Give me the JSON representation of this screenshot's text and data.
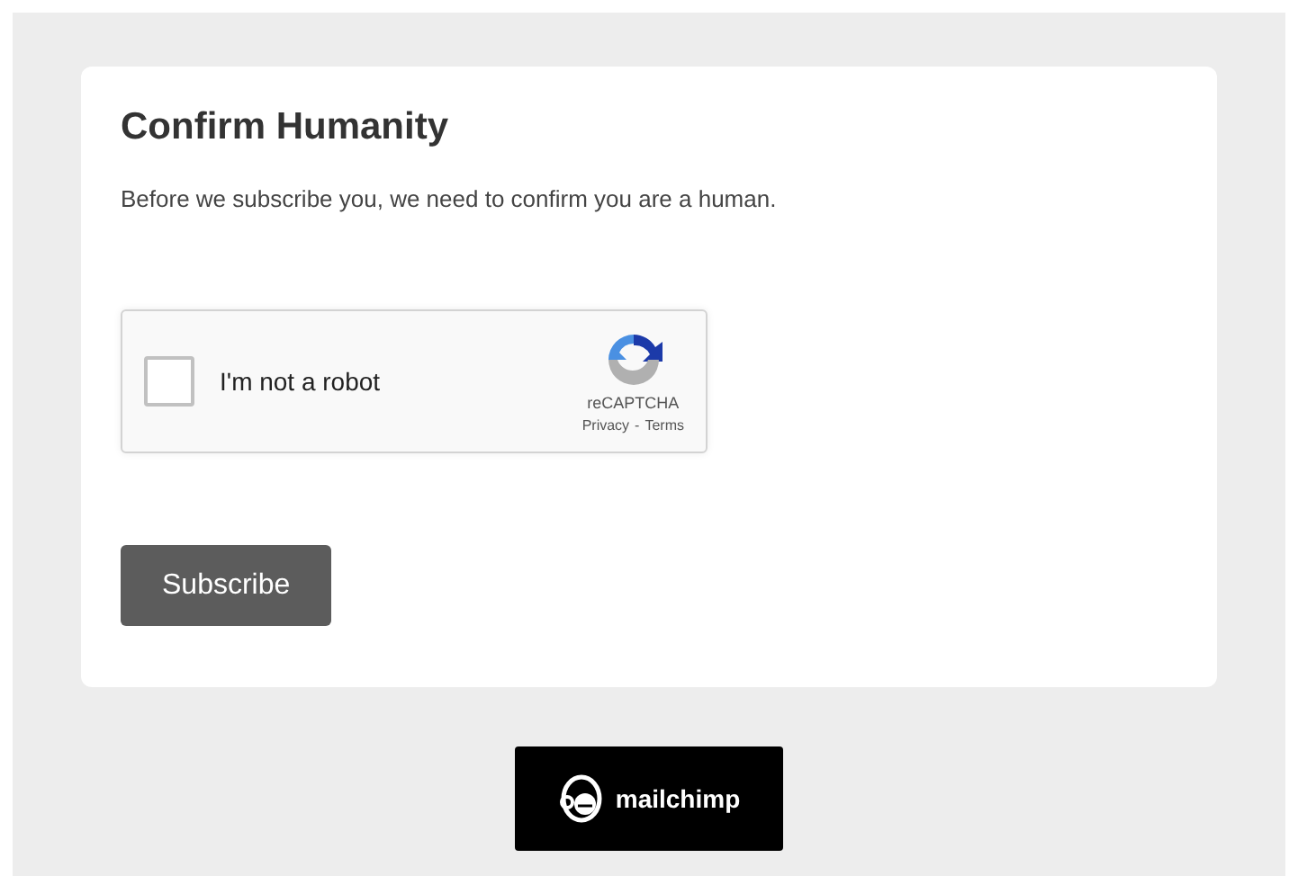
{
  "form": {
    "title": "Confirm Humanity",
    "message": "Before we subscribe you, we need to confirm you are a human."
  },
  "captcha": {
    "label": "I'm not a robot",
    "checked": false,
    "brand": "reCAPTCHA",
    "privacy_link": "Privacy",
    "separator": "-",
    "terms_link": "Terms"
  },
  "subscribe_button": "Subscribe",
  "footer_badge": {
    "text": "mailchimp"
  }
}
